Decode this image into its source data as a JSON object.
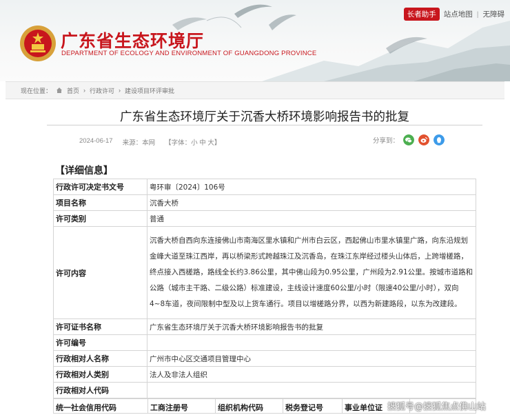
{
  "header": {
    "site_title": "广东省生态环境厅",
    "site_subtitle": "DEPARTMENT OF ECOLOGY AND ENVIRONMENT OF GUANGDONG PROVINCE",
    "top_links": {
      "elder_mode": "长者助手",
      "site_map": "站点地图",
      "separator": "|",
      "accessibility": "无障碍"
    },
    "emblem_icon": "national-emblem-icon"
  },
  "breadcrumb": {
    "label": "现在位置：",
    "items": [
      "首页",
      "行政许可",
      "建设项目环评审批"
    ],
    "separator": "›"
  },
  "article": {
    "title": "广东省生态环境厅关于沉香大桥环境影响报告书的批复",
    "date": "2024-06-17",
    "source": "来源：本网",
    "font_size_label": "【字体：小 中 大】",
    "share_label": "分享到：",
    "share_icons": [
      "wechat-icon",
      "weibo-icon",
      "qq-icon"
    ],
    "colors": {
      "wechat": "#4caf50",
      "weibo": "#e2512e",
      "qq": "#3d9be9"
    }
  },
  "detail": {
    "section_title": "【详细信息】",
    "rows": [
      {
        "key": "行政许可决定书文号",
        "value": "粤环审〔2024〕106号"
      },
      {
        "key": "项目名称",
        "value": "沉香大桥"
      },
      {
        "key": "许可类别",
        "value": "普通"
      },
      {
        "key": "许可内容",
        "value": "沉香大桥自西向东连接佛山市南海区里水镇和广州市白云区，西起佛山市里水镇里广路，向东沿规划金峰大道至珠江西岸，再以桥梁形式跨越珠江及沉香岛，在珠江东岸经过楼头山体后，上跨增槎路，终点接入西槎路，路线全长约3.86公里，其中佛山段为0.95公里，广州段为2.91公里。按城市道路和公路（城市主干路、二级公路）标准建设，主线设计速度60公里/小时（限速40公里/小时），双向4~8车道，夜间限制中型及以上货车通行。项目以增槎路分界，以西为新建路段，以东为改建段。"
      },
      {
        "key": "许可证书名称",
        "value": "广东省生态环境厅关于沉香大桥环境影响报告书的批复"
      },
      {
        "key": "许可编号",
        "value": ""
      },
      {
        "key": "行政相对人名称",
        "value": "广州市中心区交通项目管理中心"
      },
      {
        "key": "行政相对人类别",
        "value": "法人及非法人组织"
      },
      {
        "key": "行政相对人代码",
        "value": ""
      }
    ],
    "bottom_headers": [
      "统一社会信用代码",
      "工商注册号",
      "组织机构代码",
      "税务登记号",
      "事业单位证",
      ""
    ]
  },
  "watermark": "搜狐号@搜狐焦点佛山站"
}
